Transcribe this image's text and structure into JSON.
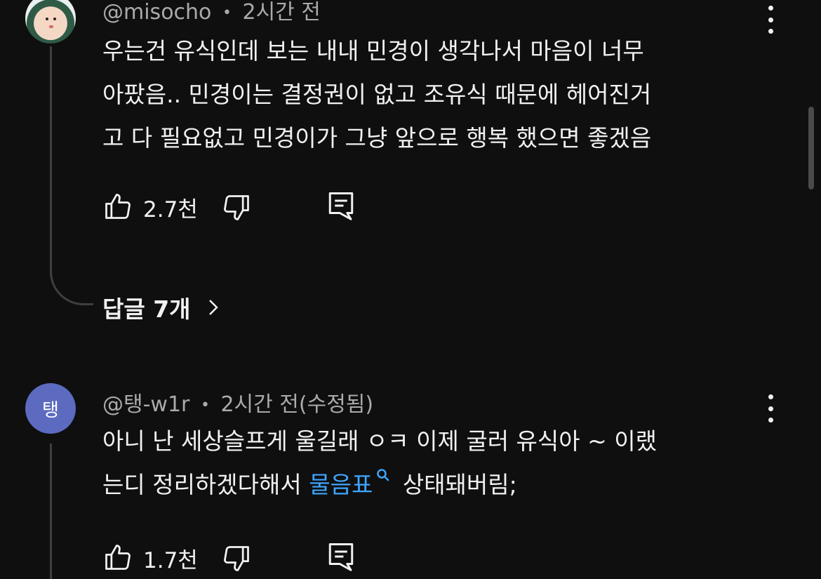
{
  "comments": [
    {
      "author": "@misocho",
      "dot": "•",
      "time": "2시간 전",
      "lines": [
        "우는건 유식인데 보는 내내 민경이 생각나서 마음이 너무",
        "아팠음.. 민경이는 결정권이 없고 조유식 때문에 헤어진거",
        "고 다 필요없고 민경이가 그냥 앞으로 행복 했으면 좋겠음"
      ],
      "likes": "2.7천",
      "replies_label": "답글 7개"
    },
    {
      "avatar_letter": "탱",
      "author": "@탱-w1r",
      "dot": "•",
      "time": "2시간 전(수정됨)",
      "line1": "아니 난 세상슬프게 울길래 ㅇㅋ 이제 굴러 유식아 ~ 이랬",
      "line2_before": "는디 정리하겠다해서 ",
      "line2_link": "물음표",
      "line2_after": " 상태돼버림;",
      "likes": "1.7천"
    }
  ],
  "colors": {
    "background": "#0f0f0f",
    "text": "#f1f1f1",
    "meta": "#aaaaaa",
    "link": "#3ea6ff",
    "avatar": "#5c6bc0"
  },
  "icons": [
    "like-icon",
    "dislike-icon",
    "reply-icon",
    "more-vert-icon",
    "chevron-right-icon",
    "search-icon"
  ]
}
